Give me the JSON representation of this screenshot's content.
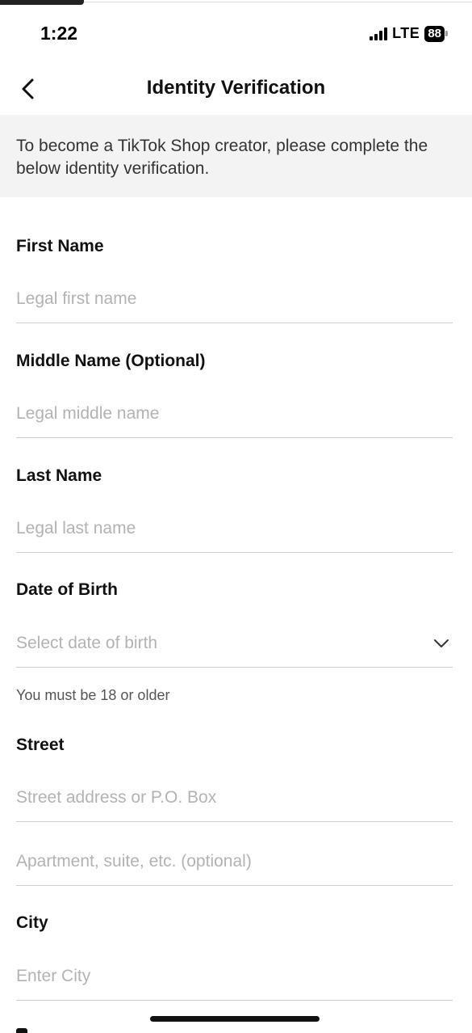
{
  "status_bar": {
    "time": "1:22",
    "network": "LTE",
    "battery": "88"
  },
  "nav": {
    "title": "Identity Verification"
  },
  "banner": {
    "text": "To become a TikTok Shop creator, please complete the below identity verification."
  },
  "form": {
    "first_name": {
      "label": "First Name",
      "placeholder": "Legal first name"
    },
    "middle_name": {
      "label": "Middle Name (Optional)",
      "placeholder": "Legal middle name"
    },
    "last_name": {
      "label": "Last Name",
      "placeholder": "Legal last name"
    },
    "dob": {
      "label": "Date of Birth",
      "placeholder": "Select date of birth",
      "hint": "You must be 18 or older"
    },
    "street": {
      "label": "Street",
      "placeholder": "Street address or P.O. Box",
      "placeholder2": "Apartment, suite, etc. (optional)"
    },
    "city": {
      "label": "City",
      "placeholder": "Enter City"
    }
  },
  "icons": {
    "back": "chevron-left-icon",
    "dropdown": "chevron-down-icon",
    "signal": "cellular-signal-icon",
    "battery": "battery-icon"
  },
  "colors": {
    "placeholder": "#b3b3b3",
    "banner_bg": "#f3f3f3",
    "divider": "#cfcfcf"
  }
}
